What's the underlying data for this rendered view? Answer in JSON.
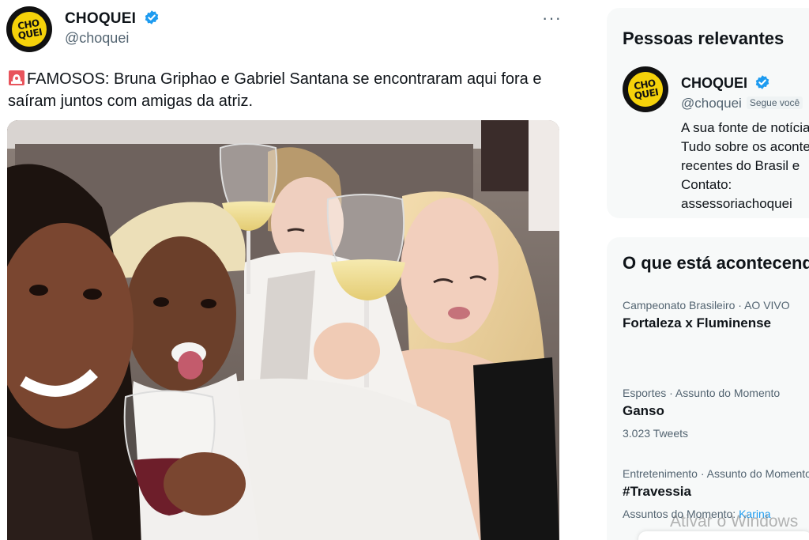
{
  "tweet": {
    "author_name": "CHOQUEI",
    "author_handle": "@choquei",
    "avatar_text_top": "CHO",
    "avatar_text_bottom": "QUEI",
    "more_label": "···",
    "text": "FAMOSOS: Bruna Griphao e Gabriel Santana se encontraram aqui fora e saíram juntos com amigas da atriz.",
    "icons": {
      "siren": "siren-icon",
      "verified": "verified-badge-icon",
      "more": "more-icon"
    }
  },
  "sidebar": {
    "relevant": {
      "title": "Pessoas relevantes",
      "name": "CHOQUEI",
      "handle": "@choquei",
      "follows_you": "Segue você",
      "bio_lines": [
        "A sua fonte de notícias",
        "Tudo sobre os acontecimentos",
        "recentes do Brasil e",
        "Contato:",
        "assessoriachoquei"
      ]
    },
    "trends": {
      "title": "O que está acontecendo",
      "items": [
        {
          "meta": "Campeonato Brasileiro · AO VIVO",
          "topic": "Fortaleza x Fluminense",
          "count": ""
        },
        {
          "meta": "Esportes · Assunto do Momento",
          "topic": "Ganso",
          "count": "3.023 Tweets"
        },
        {
          "meta": "Entretenimento · Assunto do Momento",
          "topic": "#Travessia",
          "count_prefix": "Assuntos do Momento: ",
          "count_link": "Karina"
        }
      ]
    }
  },
  "watermark": "Ativar o Windows",
  "colors": {
    "accent": "#1d9bf0",
    "secondary_text": "#536471",
    "card_bg": "#f7f9f9",
    "logo_yellow": "#f5d20a"
  }
}
